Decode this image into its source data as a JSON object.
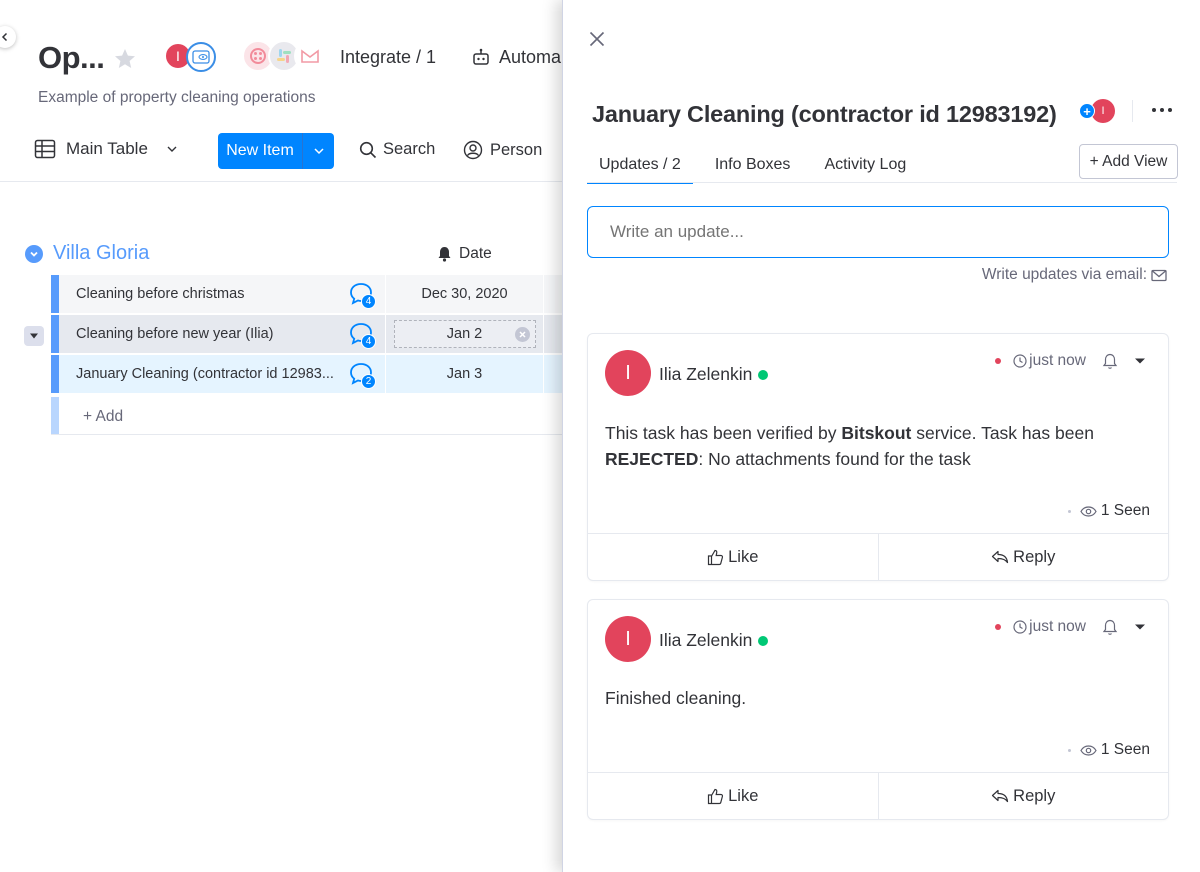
{
  "board": {
    "title": "Op...",
    "owner_initial": "I",
    "integrate_label": "Integrate / 1",
    "automate_label": "Automa",
    "description": "Example of property cleaning operations",
    "view_label": "Main Table",
    "new_item_label": "New Item",
    "search_label": "Search",
    "person_label": "Person",
    "group": {
      "title": "Villa Gloria",
      "date_column": "Date",
      "color": "#579bfc"
    },
    "rows": [
      {
        "name": "Cleaning before christmas",
        "comments": "4",
        "date": "Dec 30, 2020"
      },
      {
        "name": "Cleaning before new year (Ilia)",
        "comments": "4",
        "date": "Jan 2"
      },
      {
        "name": "January Cleaning (contractor id 12983...",
        "comments": "2",
        "date": "Jan 3"
      }
    ],
    "add_row_label": "+ Add"
  },
  "panel": {
    "title": "January Cleaning (contractor id 12983192)",
    "subscriber_initial": "I",
    "tabs": [
      "Updates / 2",
      "Info Boxes",
      "Activity Log"
    ],
    "add_view_label": "+ Add View",
    "update_placeholder": "Write an update...",
    "email_updates_label": "Write updates via email:",
    "updates": [
      {
        "author": "Ilia Zelenkin",
        "initial": "I",
        "time": "just now",
        "body_parts": [
          "This task has been verified by ",
          "Bitskout",
          " service. Task has been ",
          "REJECTED",
          ": No attachments found for the task"
        ],
        "seen": "1 Seen",
        "like_label": "Like",
        "reply_label": "Reply"
      },
      {
        "author": "Ilia Zelenkin",
        "initial": "I",
        "time": "just now",
        "body": "Finished cleaning.",
        "seen": "1 Seen",
        "like_label": "Like",
        "reply_label": "Reply"
      }
    ]
  },
  "colors": {
    "primary": "#0085ff",
    "avatar": "#e2445c",
    "online": "#00c875",
    "group": "#579bfc"
  }
}
